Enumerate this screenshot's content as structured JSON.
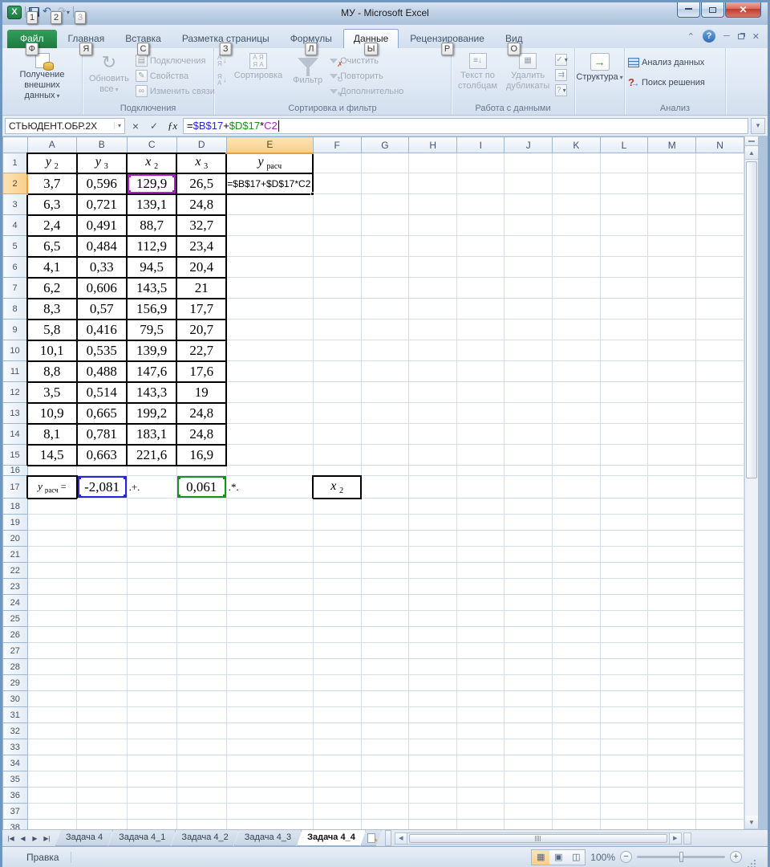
{
  "window": {
    "title": "МУ  -  Microsoft Excel"
  },
  "qat": {
    "keytips": [
      "1",
      "2",
      "3"
    ]
  },
  "ribbon_tabs": [
    {
      "label": "Файл",
      "keytip": "Ф",
      "file": true
    },
    {
      "label": "Главная",
      "keytip": "Я"
    },
    {
      "label": "Вставка",
      "keytip": "С"
    },
    {
      "label": "Разметка страницы",
      "keytip": "З"
    },
    {
      "label": "Формулы",
      "keytip": "Л"
    },
    {
      "label": "Данные",
      "keytip": "Ы",
      "active": true
    },
    {
      "label": "Рецензирование",
      "keytip": "Р"
    },
    {
      "label": "Вид",
      "keytip": "О"
    }
  ],
  "ribbon": {
    "get_external": "Получение\nвнешних данных",
    "connections": {
      "refresh": "Обновить\nвсе",
      "items": [
        "Подключения",
        "Свойства",
        "Изменить связи"
      ],
      "label": "Подключения"
    },
    "sort_filter": {
      "sort": "Сортировка",
      "filter": "Фильтр",
      "items": [
        "Очистить",
        "Повторить",
        "Дополнительно"
      ],
      "label": "Сортировка и фильтр"
    },
    "data_tools": {
      "text_to_cols": "Текст по\nстолбцам",
      "remove_dups": "Удалить\nдубликаты",
      "label": "Работа с данными"
    },
    "outline": {
      "structure": "Структура"
    },
    "analysis": {
      "items": [
        "Анализ данных",
        "Поиск решения"
      ],
      "label": "Анализ"
    }
  },
  "formula_bar": {
    "name_box": "СТЬЮДЕНТ.ОБР.2X",
    "parts": [
      {
        "text": "=",
        "color": "#000000"
      },
      {
        "text": "$B$17",
        "color": "#2626d8"
      },
      {
        "text": "+",
        "color": "#000000"
      },
      {
        "text": "$D$17",
        "color": "#1d8f1d"
      },
      {
        "text": "*",
        "color": "#000000"
      },
      {
        "text": "C2",
        "color": "#b01ec8"
      }
    ]
  },
  "grid": {
    "columns": [
      "A",
      "B",
      "C",
      "D",
      "E",
      "F",
      "G",
      "H",
      "I",
      "J",
      "K",
      "L",
      "M",
      "N"
    ],
    "visible_rows": 38,
    "active": {
      "column": "E",
      "row": 2
    },
    "header_cells": [
      {
        "cell": "A1",
        "base": "y",
        "sub": "2"
      },
      {
        "cell": "B1",
        "base": "y",
        "sub": "3"
      },
      {
        "cell": "C1",
        "base": "x",
        "sub": "2"
      },
      {
        "cell": "D1",
        "base": "x",
        "sub": "3"
      },
      {
        "cell": "E1",
        "base": "y",
        "sub": "расч"
      }
    ],
    "data_rows": [
      {
        "row": 2,
        "values": [
          "3,7",
          "0,596",
          "129,9",
          "26,5"
        ]
      },
      {
        "row": 3,
        "values": [
          "6,3",
          "0,721",
          "139,1",
          "24,8"
        ]
      },
      {
        "row": 4,
        "values": [
          "2,4",
          "0,491",
          "88,7",
          "32,7"
        ]
      },
      {
        "row": 5,
        "values": [
          "6,5",
          "0,484",
          "112,9",
          "23,4"
        ]
      },
      {
        "row": 6,
        "values": [
          "4,1",
          "0,33",
          "94,5",
          "20,4"
        ]
      },
      {
        "row": 7,
        "values": [
          "6,2",
          "0,606",
          "143,5",
          "21"
        ]
      },
      {
        "row": 8,
        "values": [
          "8,3",
          "0,57",
          "156,9",
          "17,7"
        ]
      },
      {
        "row": 9,
        "values": [
          "5,8",
          "0,416",
          "79,5",
          "20,7"
        ]
      },
      {
        "row": 10,
        "values": [
          "10,1",
          "0,535",
          "139,9",
          "22,7"
        ]
      },
      {
        "row": 11,
        "values": [
          "8,8",
          "0,488",
          "147,6",
          "17,6"
        ]
      },
      {
        "row": 12,
        "values": [
          "3,5",
          "0,514",
          "143,3",
          "19"
        ]
      },
      {
        "row": 13,
        "values": [
          "10,9",
          "0,665",
          "199,2",
          "24,8"
        ]
      },
      {
        "row": 14,
        "values": [
          "8,1",
          "0,781",
          "183,1",
          "24,8"
        ]
      },
      {
        "row": 15,
        "values": [
          "14,5",
          "0,663",
          "221,6",
          "16,9"
        ]
      }
    ],
    "row17": {
      "label": {
        "cell": "A17",
        "base": "y",
        "sub": "расч",
        "suffix": "="
      },
      "b": {
        "cell": "B17",
        "value": "-2,081",
        "ref_color": "blue"
      },
      "plus": {
        "cell": "C17",
        "value": ".+."
      },
      "d": {
        "cell": "D17",
        "value": "0,061",
        "ref_color": "green"
      },
      "times": {
        "cell": "E17",
        "value": ".*."
      },
      "x": {
        "cell": "F17",
        "base": "x",
        "sub": "2"
      }
    },
    "edit_cell": {
      "cell": "E2"
    },
    "ref_highlight": {
      "cell": "C2",
      "color": "purple"
    }
  },
  "sheet_tabs": {
    "tabs": [
      "Задача 4",
      "Задача 4_1",
      "Задача 4_2",
      "Задача 4_3",
      "Задача 4_4"
    ],
    "active": "Задача 4_4"
  },
  "status_bar": {
    "mode": "Правка",
    "zoom": "100%"
  }
}
